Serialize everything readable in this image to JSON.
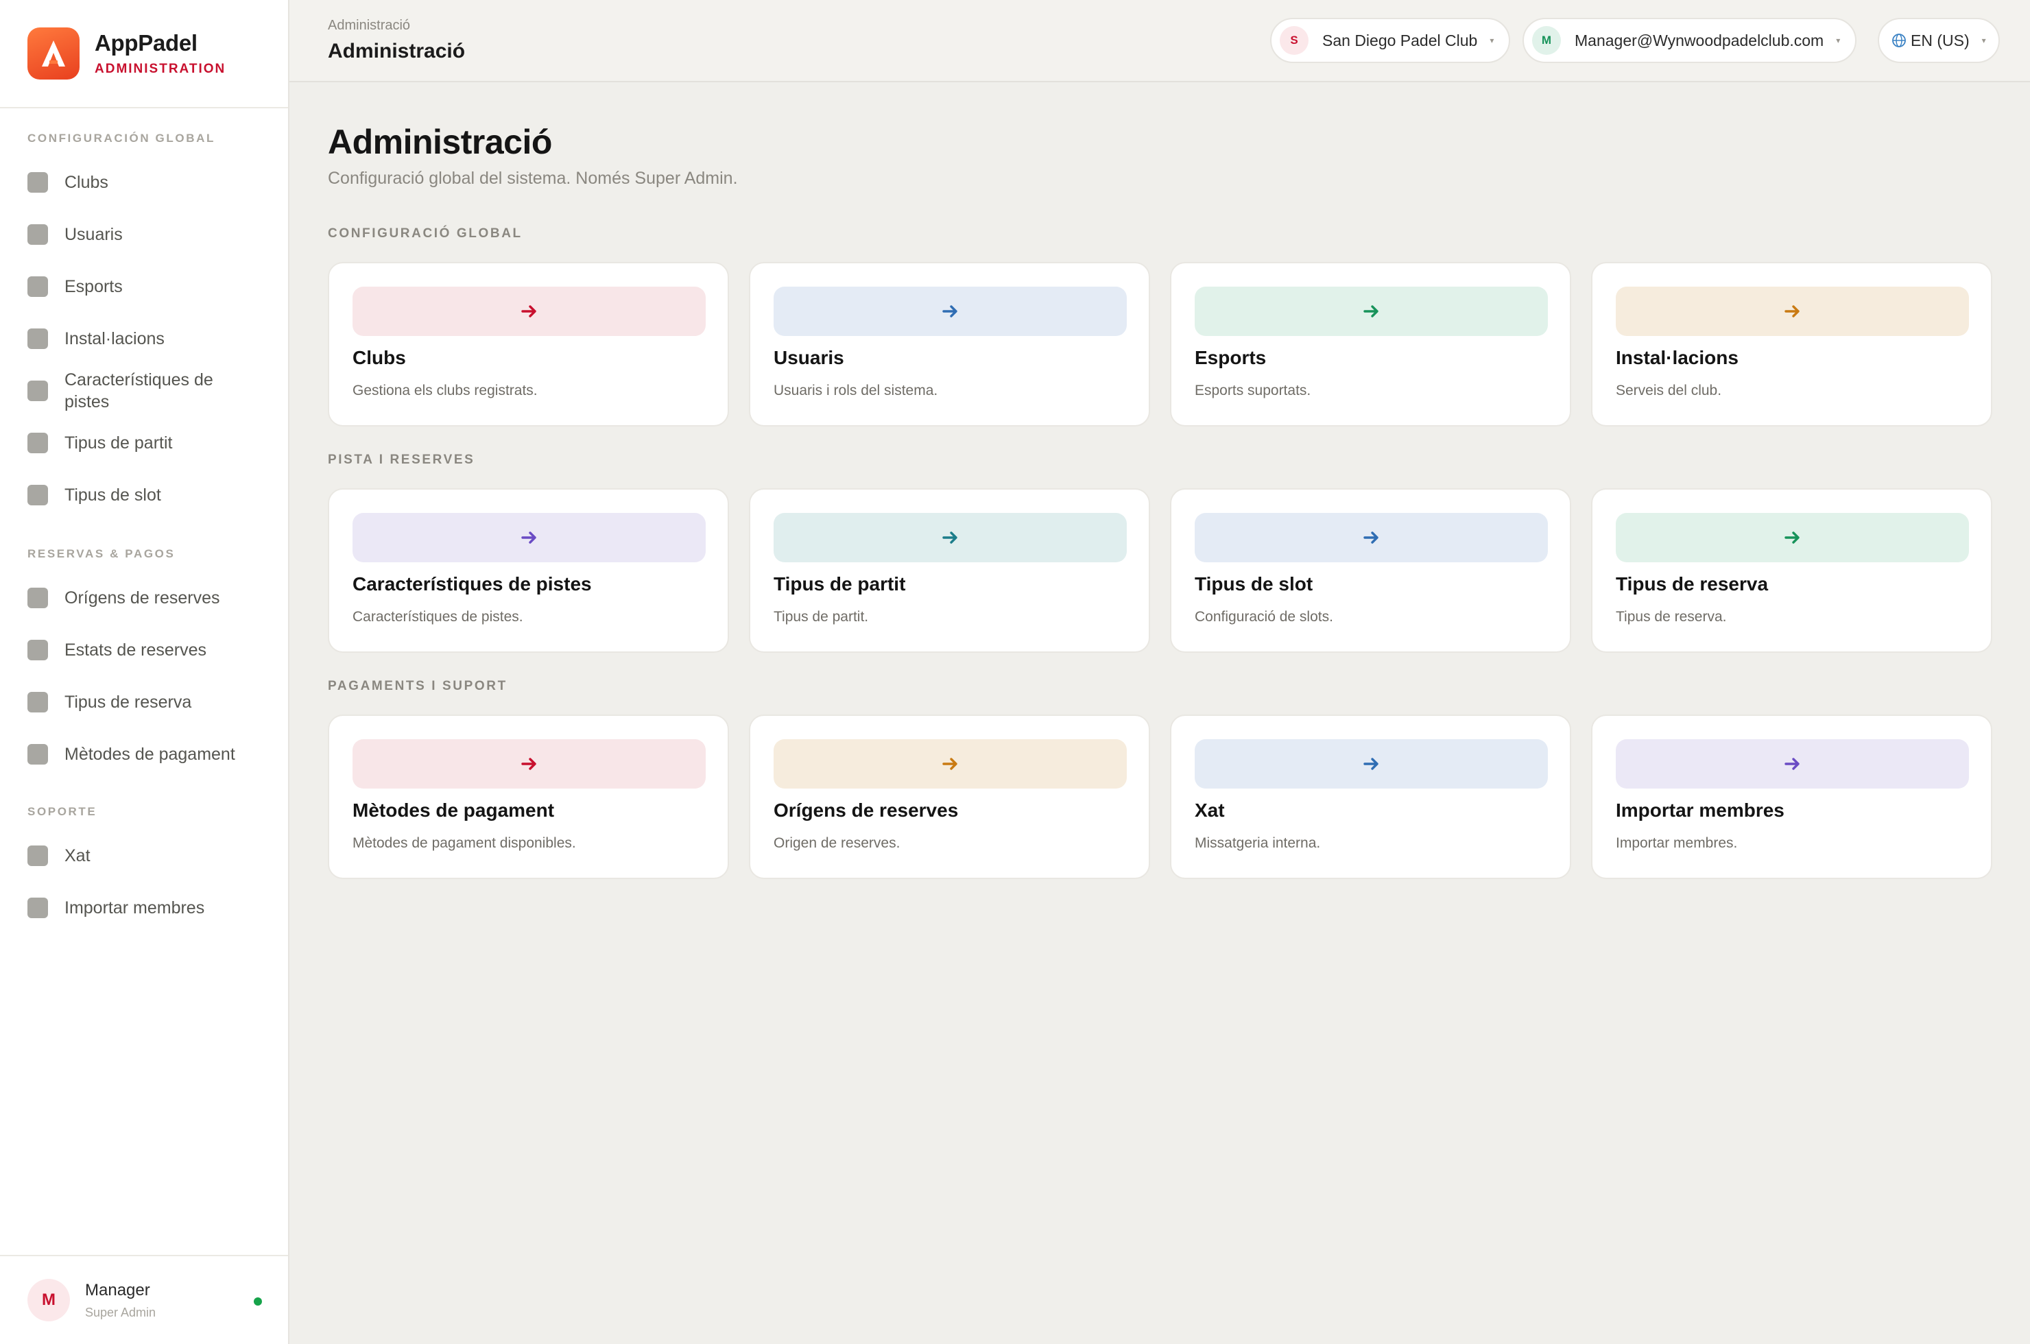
{
  "app": {
    "name": "AppPadel",
    "subtitle": "ADMINISTRATION"
  },
  "sidebar": {
    "sections": [
      {
        "label": "CONFIGURACIÓN GLOBAL",
        "items": [
          "Clubs",
          "Usuaris",
          "Esports",
          "Instal·lacions",
          "Característiques de pistes",
          "Tipus de partit",
          "Tipus de slot"
        ]
      },
      {
        "label": "RESERVAS & PAGOS",
        "items": [
          "Orígens de reserves",
          "Estats de reserves",
          "Tipus de reserva",
          "Mètodes de pagament"
        ]
      },
      {
        "label": "SOPORTE",
        "items": [
          "Xat",
          "Importar membres"
        ]
      }
    ],
    "user": {
      "initial": "M",
      "name": "Manager",
      "role": "Super Admin",
      "status_color": "#16a34a"
    }
  },
  "topbar": {
    "breadcrumb": "Administració",
    "title": "Administració",
    "club": {
      "initial": "S",
      "name": "San Diego Padel Club"
    },
    "account": {
      "initial": "M",
      "email": "Manager@Wynwoodpadelclub.com"
    },
    "language": {
      "icon": "globe-icon",
      "label": "EN (US)"
    }
  },
  "main": {
    "title": "Administració",
    "subtitle": "Configuració global del sistema. Només Super Admin.",
    "groups": [
      {
        "label": "CONFIGURACIÓ GLOBAL",
        "cards": [
          {
            "title": "Clubs",
            "desc": "Gestiona els clubs registrats.",
            "tint": "#f8e6e8",
            "arrow": "#c8102e"
          },
          {
            "title": "Usuaris",
            "desc": "Usuaris i rols del sistema.",
            "tint": "#e4ebf5",
            "arrow": "#2f6db3"
          },
          {
            "title": "Esports",
            "desc": "Esports suportats.",
            "tint": "#e1f2ea",
            "arrow": "#17935a"
          },
          {
            "title": "Instal·lacions",
            "desc": "Serveis del club.",
            "tint": "#f6ecdd",
            "arrow": "#c97a12"
          }
        ]
      },
      {
        "label": "PISTA I RESERVES",
        "cards": [
          {
            "title": "Característiques de pistes",
            "desc": "Característiques de pistes.",
            "tint": "#ebe8f6",
            "arrow": "#6a4bc4"
          },
          {
            "title": "Tipus de partit",
            "desc": "Tipus de partit.",
            "tint": "#e0eeee",
            "arrow": "#1c7d8a"
          },
          {
            "title": "Tipus de slot",
            "desc": "Configuració de slots.",
            "tint": "#e4ebf5",
            "arrow": "#2f6db3"
          },
          {
            "title": "Tipus de reserva",
            "desc": "Tipus de reserva.",
            "tint": "#e1f2ea",
            "arrow": "#17935a"
          }
        ]
      },
      {
        "label": "PAGAMENTS I SUPORT",
        "cards": [
          {
            "title": "Mètodes de pagament",
            "desc": "Mètodes de pagament disponibles.",
            "tint": "#f8e6e8",
            "arrow": "#c8102e"
          },
          {
            "title": "Orígens de reserves",
            "desc": "Origen de reserves.",
            "tint": "#f6ecdd",
            "arrow": "#c97a12"
          },
          {
            "title": "Xat",
            "desc": "Missatgeria interna.",
            "tint": "#e4ebf5",
            "arrow": "#2f6db3"
          },
          {
            "title": "Importar membres",
            "desc": "Importar membres.",
            "tint": "#ebe8f6",
            "arrow": "#6a4bc4"
          }
        ]
      }
    ]
  }
}
